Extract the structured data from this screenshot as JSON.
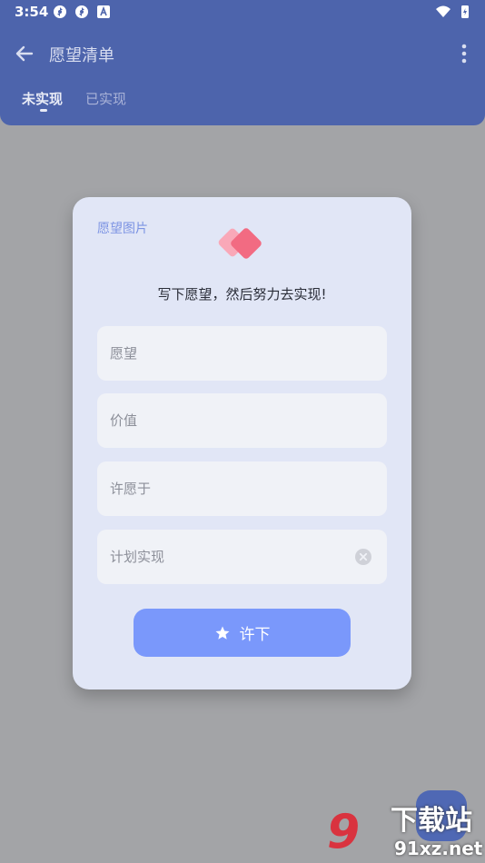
{
  "status_bar": {
    "time": "3:54",
    "left_icons": [
      "sync-icon",
      "sync-icon",
      "font-icon"
    ],
    "right_icons": [
      "wifi-icon",
      "battery-charging-icon"
    ]
  },
  "app_bar": {
    "title": "愿望清单",
    "tabs": [
      {
        "label": "未实现",
        "active": true
      },
      {
        "label": "已实现",
        "active": false
      }
    ],
    "color": "#4d64ac"
  },
  "dialog": {
    "image_label": "愿望图片",
    "subtitle": "写下愿望，然后努力去实现!",
    "fields": [
      {
        "placeholder": "愿望",
        "value": ""
      },
      {
        "placeholder": "价值",
        "value": ""
      },
      {
        "placeholder": "许愿于",
        "value": ""
      },
      {
        "placeholder": "计划实现",
        "value": ""
      }
    ],
    "submit_label": "许下",
    "accent": "#7a98fb"
  },
  "watermark": {
    "text": "下载站",
    "url": "91xz.net"
  }
}
